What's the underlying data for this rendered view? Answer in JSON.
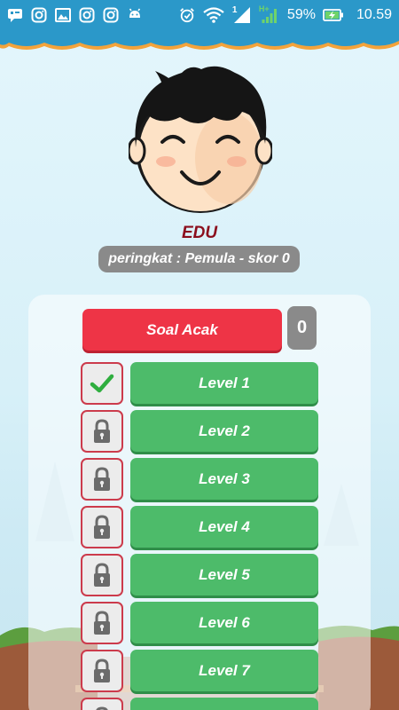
{
  "status_bar": {
    "battery": "59%",
    "time": "10.59",
    "sim_slot": "1",
    "network_type": "H+",
    "background_color": "#2b98c9"
  },
  "player": {
    "name": "EDU",
    "rank_text": "peringkat : Pemula - skor 0"
  },
  "random_quiz": {
    "label": "Soal Acak",
    "count": "0",
    "color": "#ee3446"
  },
  "levels": [
    {
      "label": "Level 1",
      "status": "completed",
      "status_icon": "check-icon"
    },
    {
      "label": "Level 2",
      "status": "locked",
      "status_icon": "lock-icon"
    },
    {
      "label": "Level 3",
      "status": "locked",
      "status_icon": "lock-icon"
    },
    {
      "label": "Level 4",
      "status": "locked",
      "status_icon": "lock-icon"
    },
    {
      "label": "Level 5",
      "status": "locked",
      "status_icon": "lock-icon"
    },
    {
      "label": "Level 6",
      "status": "locked",
      "status_icon": "lock-icon"
    },
    {
      "label": "Level 7",
      "status": "locked",
      "status_icon": "lock-icon"
    },
    {
      "label": "",
      "status": "locked",
      "status_icon": "lock-icon"
    }
  ],
  "colors": {
    "level_button": "#4dbb6a",
    "status_border": "#cc3b4c",
    "name_text": "#8b0e1d",
    "grey_badge": "#8a8a8a"
  }
}
